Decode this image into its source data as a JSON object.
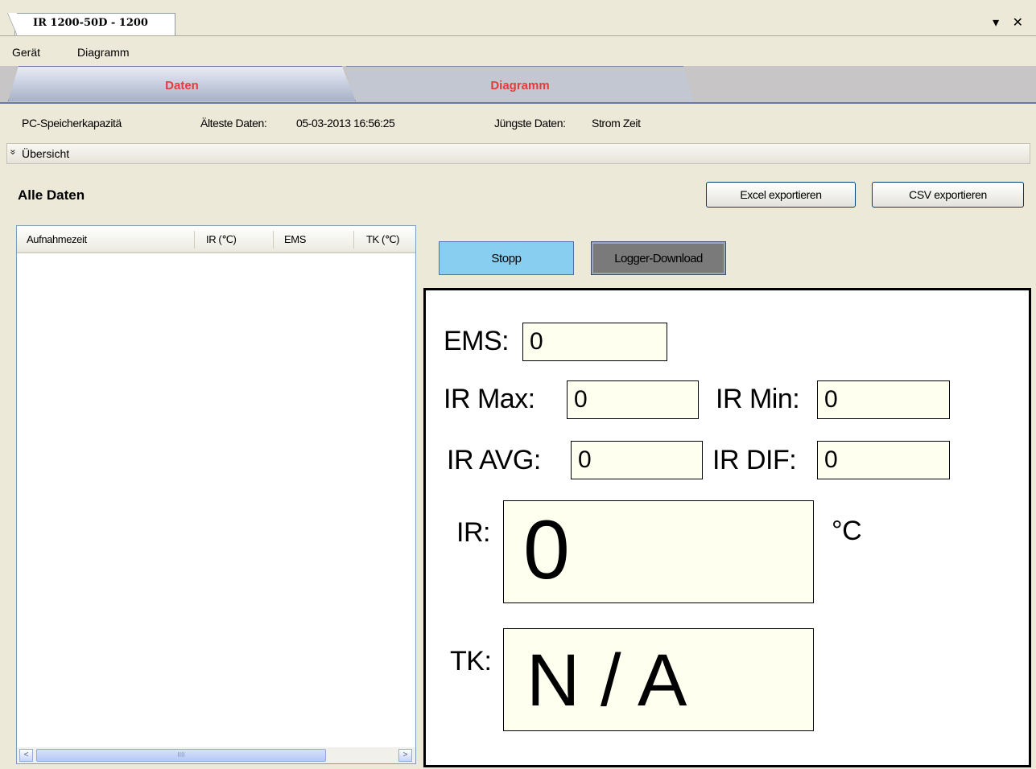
{
  "window": {
    "tab_title": "IR 1200-50D - 1200",
    "controls": "▾ ✕"
  },
  "menu": {
    "items": [
      "Gerät",
      "Diagramm"
    ]
  },
  "tabs": [
    {
      "label": "Daten",
      "active": true
    },
    {
      "label": "Diagramm",
      "active": false
    }
  ],
  "info": {
    "capacity_label": "PC-Speicherkapazitä",
    "oldest_label": "Älteste Daten:",
    "oldest_value": "05-03-2013 16:56:25",
    "newest_label": "Jüngste Daten:",
    "newest_value": "Strom Zeit"
  },
  "overview": {
    "chevron": "»",
    "label": "Übersicht"
  },
  "section_title": "Alle Daten",
  "export": {
    "excel_label": "Excel exportieren",
    "csv_label": "CSV exportieren"
  },
  "table": {
    "columns": [
      "Aufnahmezeit",
      "IR (℃)",
      "EMS",
      "TK (℃)"
    ],
    "rows": [],
    "scroll_left": "<",
    "scroll_right": ">",
    "scroll_grip": "IIII"
  },
  "actions": {
    "stopp_label": "Stopp",
    "logger_label": "Logger-Download"
  },
  "display": {
    "ems_label": "EMS:",
    "ems_value": "0",
    "ir_max_label": "IR Max:",
    "ir_max_value": "0",
    "ir_min_label": "IR Min:",
    "ir_min_value": "0",
    "ir_avg_label": "IR AVG:",
    "ir_avg_value": "0",
    "ir_dif_label": "IR DIF:",
    "ir_dif_value": "0",
    "ir_label": "IR:",
    "ir_value": "0",
    "unit": "°C",
    "tk_label": "TK:",
    "tk_value": "N / A"
  },
  "colors": {
    "tab_label": "#e53b3b",
    "stopp_button": "#87cef0",
    "logger_button": "#7a7a7a",
    "value_box": "#fffff0"
  }
}
